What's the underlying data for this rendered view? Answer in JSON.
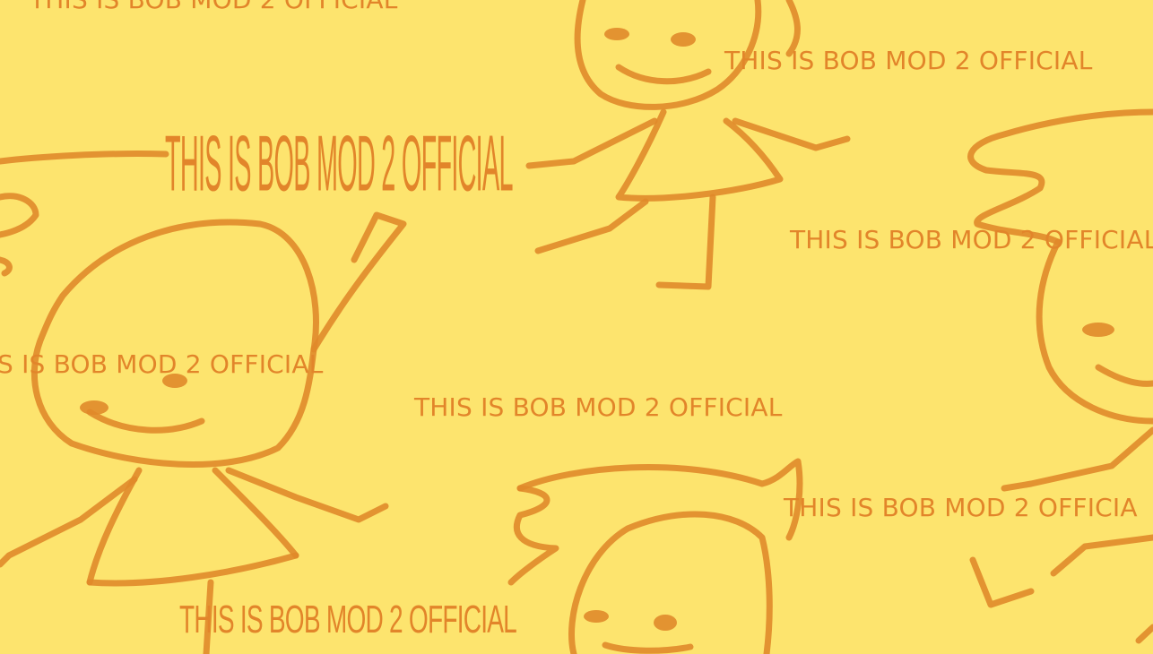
{
  "scene": {
    "background_color": "#fde46e",
    "line_color": "#e08a2a",
    "text_color": "#e2852a",
    "characters": [
      "bob-doodle",
      "bob-doodle",
      "bob-doodle",
      "bob-doodle"
    ]
  },
  "captions": [
    "THIS IS BOB MOD 2 OFFICIAL",
    "THIS IS BOB MOD 2 OFFICIAL",
    "THIS IS BOB MOD 2 OFFICIAL",
    "THIS IS BOB MOD 2 OFFICIAL",
    "S IS BOB MOD 2 OFFICIAL",
    "THIS IS BOB MOD 2 OFFICIAL",
    "THIS IS BOB MOD 2 OFFICIA",
    "THIS IS BOB MOD 2 OFFICIAL"
  ]
}
